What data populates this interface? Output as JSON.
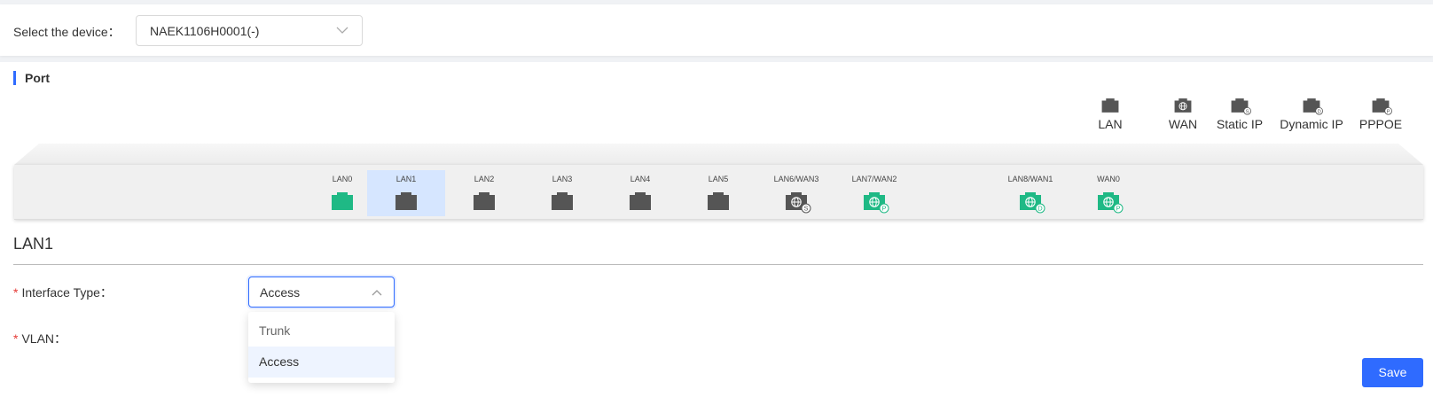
{
  "device_bar": {
    "label": "Select the device：",
    "selected_device": "NAEK1106H0001(-)"
  },
  "section": {
    "title": "Port"
  },
  "legend": [
    {
      "label": "LAN",
      "type": "lan",
      "badge": ""
    },
    {
      "label": "WAN",
      "type": "wan",
      "badge": ""
    },
    {
      "label": "Static IP",
      "type": "lan",
      "badge": "S"
    },
    {
      "label": "Dynamic IP",
      "type": "lan",
      "badge": "D"
    },
    {
      "label": "PPPOE",
      "type": "lan",
      "badge": "P"
    }
  ],
  "ports": [
    {
      "name": "LAN0",
      "type": "lan",
      "color": "#1fb985",
      "badge": "",
      "selected": false
    },
    {
      "name": "LAN1",
      "type": "lan",
      "color": "#555555",
      "badge": "",
      "selected": true
    },
    {
      "name": "LAN2",
      "type": "lan",
      "color": "#555555",
      "badge": "",
      "selected": false
    },
    {
      "name": "LAN3",
      "type": "lan",
      "color": "#555555",
      "badge": "",
      "selected": false
    },
    {
      "name": "LAN4",
      "type": "lan",
      "color": "#555555",
      "badge": "",
      "selected": false
    },
    {
      "name": "LAN5",
      "type": "lan",
      "color": "#555555",
      "badge": "",
      "selected": false
    },
    {
      "name": "LAN6/WAN3",
      "type": "wan",
      "color": "#555555",
      "badge": "S",
      "selected": false
    },
    {
      "name": "LAN7/WAN2",
      "type": "wan",
      "color": "#1fb985",
      "badge": "P",
      "selected": false
    },
    {
      "name": "LAN8/WAN1",
      "type": "wan",
      "color": "#1fb985",
      "badge": "D",
      "selected": false
    },
    {
      "name": "WAN0",
      "type": "wan",
      "color": "#1fb985",
      "badge": "P",
      "selected": false
    }
  ],
  "form": {
    "title": "LAN1",
    "required_mark": "*",
    "interface_type_label": "Interface Type：",
    "interface_type_value": "Access",
    "vlan_label": "VLAN：",
    "options": [
      "Trunk",
      "Access"
    ],
    "save_label": "Save"
  },
  "colors": {
    "accent": "#2f6bff",
    "port_active": "#1fb985",
    "port_inactive": "#555555",
    "selected_bg": "#d6e6ff"
  }
}
